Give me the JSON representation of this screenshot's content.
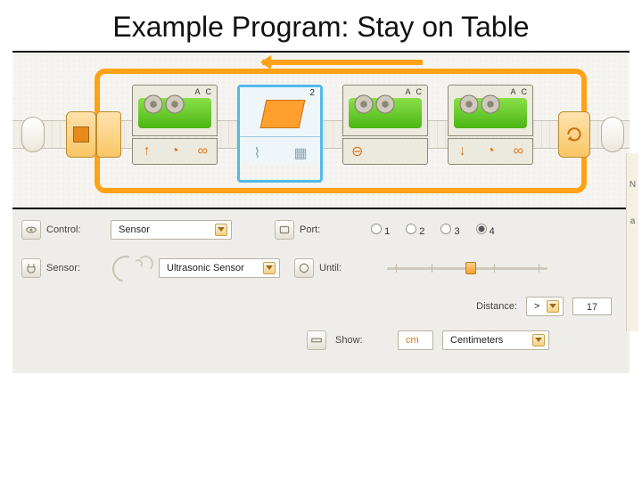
{
  "title": "Example Program: Stay on Table",
  "blocks": {
    "move1": {
      "ports": "A C"
    },
    "sensor": {
      "port": "2"
    },
    "move2": {
      "ports": "A C"
    },
    "move3": {
      "ports": "A C"
    }
  },
  "config": {
    "control_label": "Control:",
    "control_value": "Sensor",
    "sensor_label": "Sensor:",
    "sensor_value": "Ultrasonic Sensor",
    "port_label": "Port:",
    "ports": [
      "1",
      "2",
      "3",
      "4"
    ],
    "port_selected": "4",
    "until_label": "Until:",
    "distance_label": "Distance:",
    "compare": ">",
    "distance_value": "17",
    "show_label": "Show:",
    "show_unit_short": "cm",
    "show_unit": "Centimeters"
  },
  "edge": {
    "n": "N",
    "a": "a"
  }
}
